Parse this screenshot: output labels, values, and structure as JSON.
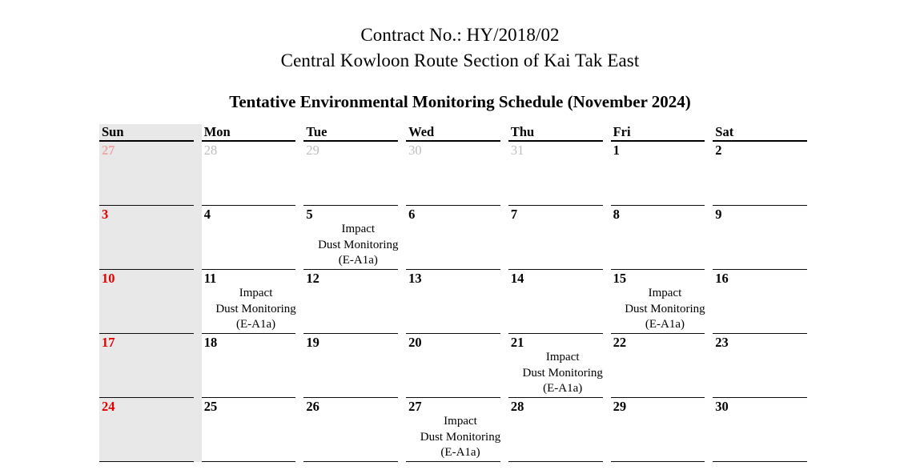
{
  "document": {
    "contract_line": "Contract No.: HY/2018/02",
    "project_line": "Central Kowloon Route Section of Kai Tak East",
    "schedule_title": "Tentative Environmental Monitoring Schedule (November 2024)"
  },
  "colors": {
    "sunday_column_background": "#e8e8e8",
    "sunday_date": "#e00000",
    "sunday_date_other_month": "#f0a8a8",
    "other_month_date": "#bdbdbd",
    "rule": "#000000",
    "page_background": "#ffffff"
  },
  "calendar": {
    "month": "November",
    "year": "2024",
    "weekday_headers": [
      "Sun",
      "Mon",
      "Tue",
      "Wed",
      "Thu",
      "Fri",
      "Sat"
    ],
    "event_label": {
      "line1": "Impact",
      "line2": "Dust Monitoring",
      "line3": "(E-A1a)"
    },
    "weeks": [
      [
        {
          "date": "27",
          "in_month": false,
          "is_sunday": true,
          "event": false
        },
        {
          "date": "28",
          "in_month": false,
          "is_sunday": false,
          "event": false
        },
        {
          "date": "29",
          "in_month": false,
          "is_sunday": false,
          "event": false
        },
        {
          "date": "30",
          "in_month": false,
          "is_sunday": false,
          "event": false
        },
        {
          "date": "31",
          "in_month": false,
          "is_sunday": false,
          "event": false
        },
        {
          "date": "1",
          "in_month": true,
          "is_sunday": false,
          "event": false
        },
        {
          "date": "2",
          "in_month": true,
          "is_sunday": false,
          "event": false
        }
      ],
      [
        {
          "date": "3",
          "in_month": true,
          "is_sunday": true,
          "event": false
        },
        {
          "date": "4",
          "in_month": true,
          "is_sunday": false,
          "event": false
        },
        {
          "date": "5",
          "in_month": true,
          "is_sunday": false,
          "event": true
        },
        {
          "date": "6",
          "in_month": true,
          "is_sunday": false,
          "event": false
        },
        {
          "date": "7",
          "in_month": true,
          "is_sunday": false,
          "event": false
        },
        {
          "date": "8",
          "in_month": true,
          "is_sunday": false,
          "event": false
        },
        {
          "date": "9",
          "in_month": true,
          "is_sunday": false,
          "event": false
        }
      ],
      [
        {
          "date": "10",
          "in_month": true,
          "is_sunday": true,
          "event": false
        },
        {
          "date": "11",
          "in_month": true,
          "is_sunday": false,
          "event": true
        },
        {
          "date": "12",
          "in_month": true,
          "is_sunday": false,
          "event": false
        },
        {
          "date": "13",
          "in_month": true,
          "is_sunday": false,
          "event": false
        },
        {
          "date": "14",
          "in_month": true,
          "is_sunday": false,
          "event": false
        },
        {
          "date": "15",
          "in_month": true,
          "is_sunday": false,
          "event": true
        },
        {
          "date": "16",
          "in_month": true,
          "is_sunday": false,
          "event": false
        }
      ],
      [
        {
          "date": "17",
          "in_month": true,
          "is_sunday": true,
          "event": false
        },
        {
          "date": "18",
          "in_month": true,
          "is_sunday": false,
          "event": false
        },
        {
          "date": "19",
          "in_month": true,
          "is_sunday": false,
          "event": false
        },
        {
          "date": "20",
          "in_month": true,
          "is_sunday": false,
          "event": false
        },
        {
          "date": "21",
          "in_month": true,
          "is_sunday": false,
          "event": true
        },
        {
          "date": "22",
          "in_month": true,
          "is_sunday": false,
          "event": false
        },
        {
          "date": "23",
          "in_month": true,
          "is_sunday": false,
          "event": false
        }
      ],
      [
        {
          "date": "24",
          "in_month": true,
          "is_sunday": true,
          "event": false
        },
        {
          "date": "25",
          "in_month": true,
          "is_sunday": false,
          "event": false
        },
        {
          "date": "26",
          "in_month": true,
          "is_sunday": false,
          "event": false
        },
        {
          "date": "27",
          "in_month": true,
          "is_sunday": false,
          "event": true
        },
        {
          "date": "28",
          "in_month": true,
          "is_sunday": false,
          "event": false
        },
        {
          "date": "29",
          "in_month": true,
          "is_sunday": false,
          "event": false
        },
        {
          "date": "30",
          "in_month": true,
          "is_sunday": false,
          "event": false
        }
      ]
    ]
  }
}
